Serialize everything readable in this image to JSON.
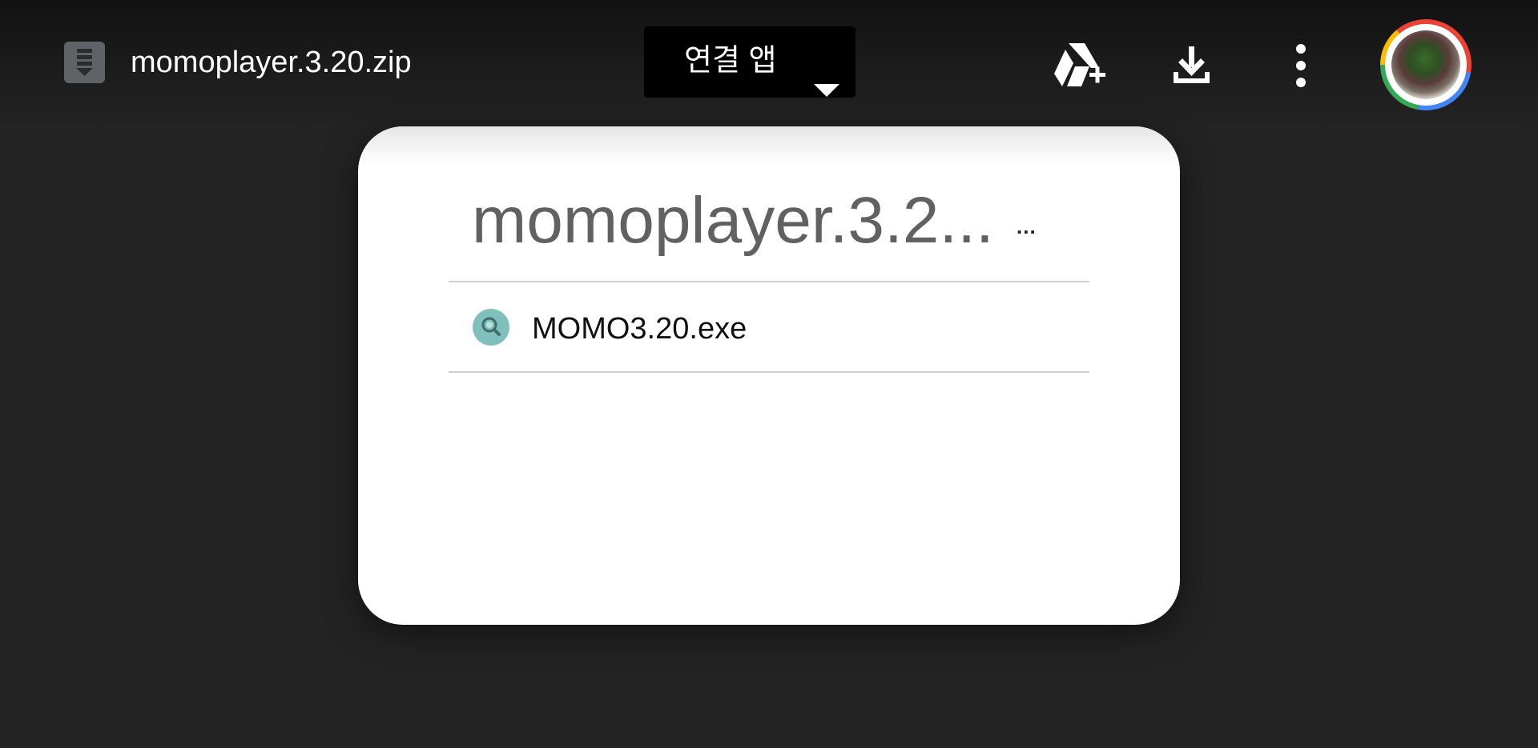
{
  "header": {
    "file_type_icon": "zip-file-icon",
    "file_name": "momoplayer.3.20.zip",
    "open_with_label": "연결 앱",
    "add_to_drive_icon": "add-to-drive-icon",
    "download_icon": "download-icon",
    "more_icon": "more-vert-icon",
    "avatar_icon": "account-avatar"
  },
  "archive": {
    "title": "momoplayer.3.2...",
    "title_overflow": "...",
    "items": [
      {
        "name": "MOMO3.20.exe",
        "icon": "exe-file-icon"
      }
    ]
  },
  "colors": {
    "background": "#232323",
    "card": "#ffffff",
    "title_gray": "#616161",
    "exe_icon": "#7fc0bd"
  }
}
